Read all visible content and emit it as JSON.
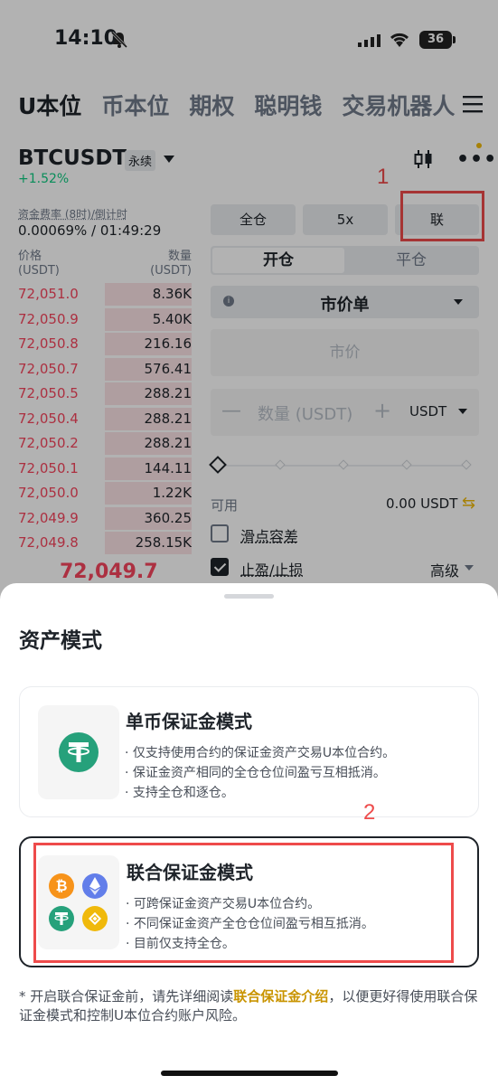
{
  "status_bar": {
    "time": "14:10",
    "battery": "36"
  },
  "top_nav": {
    "tabs": [
      "U本位",
      "币本位",
      "期权",
      "聪明钱",
      "交易机器人"
    ]
  },
  "ticker": {
    "symbol": "BTCUSDT",
    "contract_type": "永续",
    "change": "+1.52%"
  },
  "funding": {
    "label": "资金费率 (8时)/倒计时",
    "value": "0.00069% / 01:49:29"
  },
  "orderbook": {
    "price_label": "价格",
    "price_unit": "(USDT)",
    "qty_label": "数量",
    "qty_unit": "(USDT)",
    "rows": [
      {
        "price": "72,051.0",
        "qty": "8.36K",
        "depth": 0.5
      },
      {
        "price": "72,050.9",
        "qty": "5.40K",
        "depth": 0.5
      },
      {
        "price": "72,050.8",
        "qty": "216.16",
        "depth": 0.5
      },
      {
        "price": "72,050.7",
        "qty": "576.41",
        "depth": 0.5
      },
      {
        "price": "72,050.5",
        "qty": "288.21",
        "depth": 0.5
      },
      {
        "price": "72,050.4",
        "qty": "288.21",
        "depth": 0.5
      },
      {
        "price": "72,050.2",
        "qty": "288.21",
        "depth": 0.5
      },
      {
        "price": "72,050.1",
        "qty": "144.11",
        "depth": 0.5
      },
      {
        "price": "72,050.0",
        "qty": "1.22K",
        "depth": 0.5
      },
      {
        "price": "72,049.9",
        "qty": "360.25",
        "depth": 0.5
      },
      {
        "price": "72,049.8",
        "qty": "258.15K",
        "depth": 0.5
      }
    ],
    "last_price": "72,049.7"
  },
  "trade_panel": {
    "margin_mode": "全仓",
    "leverage": "5x",
    "asset_mode": "联",
    "open_tab": "开仓",
    "close_tab": "平仓",
    "order_type": "市价单",
    "price_placeholder": "市价",
    "qty_placeholder": "数量 (USDT)",
    "qty_unit": "USDT",
    "available_label": "可用",
    "available_value": "0.00 USDT",
    "slippage_label": "滑点容差",
    "tpsl_label": "止盈/止损",
    "advanced_label": "高级"
  },
  "annotations": {
    "marker_1": "1",
    "marker_2": "2",
    "accent_color": "#ee4b4b"
  },
  "sheet": {
    "title": "资产模式",
    "single": {
      "title": "单币保证金模式",
      "lines": [
        "· 仅支持使用合约的保证金资产交易U本位合约。",
        "· 保证金资产相同的全仓仓位间盈亏互相抵消。",
        "· 支持全仓和逐仓。"
      ]
    },
    "multi": {
      "title": "联合保证金模式",
      "lines": [
        "· 可跨保证金资产交易U本位合约。",
        "· 不同保证金资产全仓仓位间盈亏相互抵消。",
        "· 目前仅支持全仓。"
      ]
    },
    "footnote_before": "开启联合保证金前，请先详细阅读",
    "footnote_link": "联合保证金介绍",
    "footnote_after": "，以便更好得使用联合保证金模式和控制U本位合约账户风险。"
  }
}
